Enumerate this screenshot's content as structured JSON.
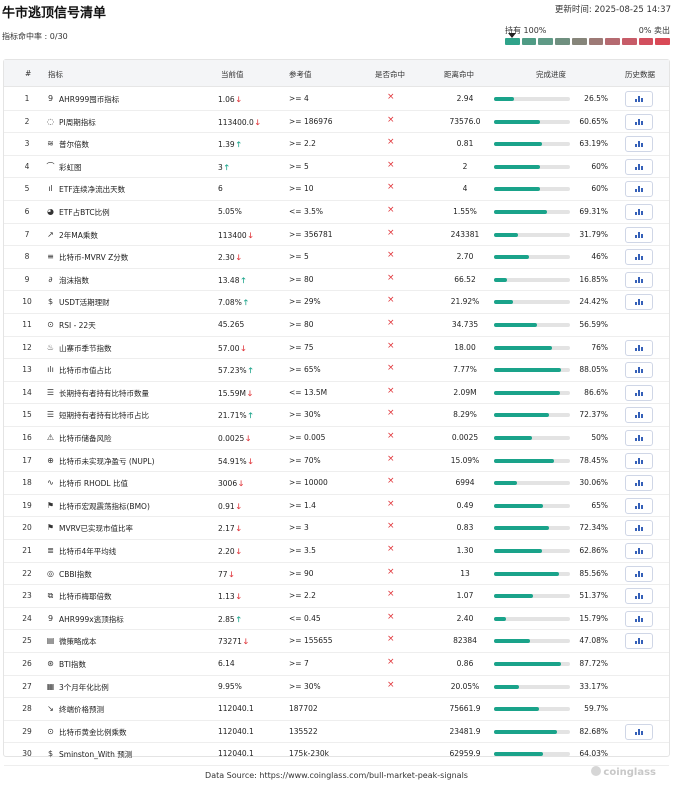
{
  "page": {
    "title": "牛市逃顶信号清单",
    "updated": "更新时间: 2025-08-25 14:37",
    "hit_rate": "指标命中率 : 0/30",
    "hold_label": "持有 100%",
    "sell_label": "0% 卖出"
  },
  "gradient_colors": [
    "#2fa38a",
    "#4f9b84",
    "#5f9a86",
    "#6f8f7f",
    "#86857a",
    "#9d7a76",
    "#b56a70",
    "#c75c68",
    "#d24f5e",
    "#d94956"
  ],
  "headers": {
    "no": "#",
    "name": "指标",
    "current": "当前值",
    "reference": "参考值",
    "hit": "是否命中",
    "distance": "距离命中",
    "progress": "完成进度",
    "history": "历史数据"
  },
  "rows": [
    {
      "no": "1",
      "icon": "square-9-icon",
      "icon_glyph": "9",
      "name": "AHR999囤币指标",
      "current": "1.06",
      "trend": "down",
      "reference": ">= 4",
      "hit": "×",
      "distance": "2.94",
      "progress": 26.5,
      "progress_text": "26.5%",
      "history": true
    },
    {
      "no": "2",
      "icon": "pi-cycle-icon",
      "icon_glyph": "◌",
      "name": "PI周期指标",
      "current": "113400.0",
      "trend": "down",
      "reference": ">= 186976",
      "hit": "×",
      "distance": "73576.0",
      "progress": 60.65,
      "progress_text": "60.65%",
      "history": true
    },
    {
      "no": "3",
      "icon": "puell-icon",
      "icon_glyph": "≋",
      "name": "普尔倍数",
      "current": "1.39",
      "trend": "up",
      "reference": ">= 2.2",
      "hit": "×",
      "distance": "0.81",
      "progress": 63.19,
      "progress_text": "63.19%",
      "history": true
    },
    {
      "no": "4",
      "icon": "rainbow-icon",
      "icon_glyph": "⌒",
      "name": "彩虹图",
      "current": "3",
      "trend": "up",
      "reference": ">= 5",
      "hit": "×",
      "distance": "2",
      "progress": 60,
      "progress_text": "60%",
      "history": true
    },
    {
      "no": "5",
      "icon": "bar-chart-icon",
      "icon_glyph": "ıl",
      "name": "ETF连续净流出天数",
      "current": "6",
      "trend": "",
      "reference": ">= 10",
      "hit": "×",
      "distance": "4",
      "progress": 60,
      "progress_text": "60%",
      "history": true
    },
    {
      "no": "6",
      "icon": "pie-chart-icon",
      "icon_glyph": "◕",
      "name": "ETF占BTC比例",
      "current": "5.05%",
      "trend": "",
      "reference": "<= 3.5%",
      "hit": "×",
      "distance": "1.55%",
      "progress": 69.31,
      "progress_text": "69.31%",
      "history": true
    },
    {
      "no": "7",
      "icon": "area-chart-icon",
      "icon_glyph": "↗",
      "name": "2年MA乘数",
      "current": "113400",
      "trend": "down",
      "reference": ">= 356781",
      "hit": "×",
      "distance": "243381",
      "progress": 31.79,
      "progress_text": "31.79%",
      "history": true
    },
    {
      "no": "8",
      "icon": "list-chart-icon",
      "icon_glyph": "≡",
      "name": "比特币-MVRV Z分数",
      "current": "2.30",
      "trend": "down",
      "reference": ">= 5",
      "hit": "×",
      "distance": "2.70",
      "progress": 46,
      "progress_text": "46%",
      "history": true
    },
    {
      "no": "9",
      "icon": "bubble-icon",
      "icon_glyph": "∂",
      "name": "泡沫指数",
      "current": "13.48",
      "trend": "up",
      "reference": ">= 80",
      "hit": "×",
      "distance": "66.52",
      "progress": 16.85,
      "progress_text": "16.85%",
      "history": true
    },
    {
      "no": "10",
      "icon": "dollar-icon",
      "icon_glyph": "$",
      "name": "USDT活期理财",
      "current": "7.08%",
      "trend": "up",
      "reference": ">= 29%",
      "hit": "×",
      "distance": "21.92%",
      "progress": 24.42,
      "progress_text": "24.42%",
      "history": true
    },
    {
      "no": "11",
      "icon": "rsi-icon",
      "icon_glyph": "⊙",
      "name": "RSI - 22天",
      "current": "45.265",
      "trend": "",
      "reference": ">= 80",
      "hit": "×",
      "distance": "34.735",
      "progress": 56.59,
      "progress_text": "56.59%",
      "history": false
    },
    {
      "no": "12",
      "icon": "altseason-icon",
      "icon_glyph": "♨",
      "name": "山寨币季节指数",
      "current": "57.00",
      "trend": "down",
      "reference": ">= 75",
      "hit": "×",
      "distance": "18.00",
      "progress": 76,
      "progress_text": "76%",
      "history": true
    },
    {
      "no": "13",
      "icon": "dominance-icon",
      "icon_glyph": "ılı",
      "name": "比特币市值占比",
      "current": "57.23%",
      "trend": "up",
      "reference": ">= 65%",
      "hit": "×",
      "distance": "7.77%",
      "progress": 88.05,
      "progress_text": "88.05%",
      "history": true
    },
    {
      "no": "14",
      "icon": "database-icon",
      "icon_glyph": "☰",
      "name": "长期持有者持有比特币数量",
      "current": "15.59M",
      "trend": "down",
      "reference": "<= 13.5M",
      "hit": "×",
      "distance": "2.09M",
      "progress": 86.6,
      "progress_text": "86.6%",
      "history": true
    },
    {
      "no": "15",
      "icon": "database-icon",
      "icon_glyph": "☰",
      "name": "短期持有者持有比特币占比",
      "current": "21.71%",
      "trend": "up",
      "reference": ">= 30%",
      "hit": "×",
      "distance": "8.29%",
      "progress": 72.37,
      "progress_text": "72.37%",
      "history": true
    },
    {
      "no": "16",
      "icon": "reserve-risk-icon",
      "icon_glyph": "⚠",
      "name": "比特币储备风险",
      "current": "0.0025",
      "trend": "down",
      "reference": ">= 0.005",
      "hit": "×",
      "distance": "0.0025",
      "progress": 50,
      "progress_text": "50%",
      "history": true
    },
    {
      "no": "17",
      "icon": "nupl-icon",
      "icon_glyph": "⊕",
      "name": "比特币未实现净盈亏 (NUPL)",
      "current": "54.91%",
      "trend": "down",
      "reference": ">= 70%",
      "hit": "×",
      "distance": "15.09%",
      "progress": 78.45,
      "progress_text": "78.45%",
      "history": true
    },
    {
      "no": "18",
      "icon": "rhodl-icon",
      "icon_glyph": "∿",
      "name": "比特币 RHODL 比值",
      "current": "3006",
      "trend": "down",
      "reference": ">= 10000",
      "hit": "×",
      "distance": "6994",
      "progress": 30.06,
      "progress_text": "30.06%",
      "history": true
    },
    {
      "no": "19",
      "icon": "bmo-icon",
      "icon_glyph": "⚑",
      "name": "比特币宏观震荡指标(BMO)",
      "current": "0.91",
      "trend": "down",
      "reference": ">= 1.4",
      "hit": "×",
      "distance": "0.49",
      "progress": 65,
      "progress_text": "65%",
      "history": true
    },
    {
      "no": "20",
      "icon": "mvrv-icon",
      "icon_glyph": "⚑",
      "name": "MVRV已实现市值比率",
      "current": "2.17",
      "trend": "down",
      "reference": ">= 3",
      "hit": "×",
      "distance": "0.83",
      "progress": 72.34,
      "progress_text": "72.34%",
      "history": true
    },
    {
      "no": "21",
      "icon": "ma4y-icon",
      "icon_glyph": "≣",
      "name": "比特币4年平均线",
      "current": "2.20",
      "trend": "down",
      "reference": ">= 3.5",
      "hit": "×",
      "distance": "1.30",
      "progress": 62.86,
      "progress_text": "62.86%",
      "history": true
    },
    {
      "no": "22",
      "icon": "cbbi-icon",
      "icon_glyph": "◎",
      "name": "CBBI指数",
      "current": "77",
      "trend": "down",
      "reference": ">= 90",
      "hit": "×",
      "distance": "13",
      "progress": 85.56,
      "progress_text": "85.56%",
      "history": true
    },
    {
      "no": "23",
      "icon": "mayer-icon",
      "icon_glyph": "⧉",
      "name": "比特币梅耶倍数",
      "current": "1.13",
      "trend": "down",
      "reference": ">= 2.2",
      "hit": "×",
      "distance": "1.07",
      "progress": 51.37,
      "progress_text": "51.37%",
      "history": true
    },
    {
      "no": "24",
      "icon": "square-9-icon",
      "icon_glyph": "9",
      "name": "AHR999x逃顶指标",
      "current": "2.85",
      "trend": "up",
      "reference": "<= 0.45",
      "hit": "×",
      "distance": "2.40",
      "progress": 15.79,
      "progress_text": "15.79%",
      "history": true
    },
    {
      "no": "25",
      "icon": "microstrategy-icon",
      "icon_glyph": "▤",
      "name": "微策略成本",
      "current": "73271",
      "trend": "down",
      "reference": ">= 155655",
      "hit": "×",
      "distance": "82384",
      "progress": 47.08,
      "progress_text": "47.08%",
      "history": true
    },
    {
      "no": "26",
      "icon": "bti-icon",
      "icon_glyph": "⊛",
      "name": "BTI指数",
      "current": "6.14",
      "trend": "",
      "reference": ">= 7",
      "hit": "×",
      "distance": "0.86",
      "progress": 87.72,
      "progress_text": "87.72%",
      "history": false
    },
    {
      "no": "27",
      "icon": "calendar-icon",
      "icon_glyph": "▦",
      "name": "3个月年化比例",
      "current": "9.95%",
      "trend": "",
      "reference": ">= 30%",
      "hit": "×",
      "distance": "20.05%",
      "progress": 33.17,
      "progress_text": "33.17%",
      "history": false
    },
    {
      "no": "28",
      "icon": "trend-icon",
      "icon_glyph": "↘",
      "name": "终端价格预测",
      "current": "112040.1",
      "trend": "",
      "reference": "187702",
      "hit": "",
      "distance": "75661.9",
      "progress": 59.7,
      "progress_text": "59.7%",
      "history": false
    },
    {
      "no": "29",
      "icon": "gold-ratio-icon",
      "icon_glyph": "⊙",
      "name": "比特币黄金比例乘数",
      "current": "112040.1",
      "trend": "",
      "reference": "135522",
      "hit": "",
      "distance": "23481.9",
      "progress": 82.68,
      "progress_text": "82.68%",
      "history": true
    },
    {
      "no": "30",
      "icon": "smin-icon",
      "icon_glyph": "$",
      "name": "Sminston_With 预测",
      "current": "112040.1",
      "trend": "",
      "reference": "175k-230k",
      "hit": "",
      "distance": "62959.9",
      "progress": 64.03,
      "progress_text": "64.03%",
      "history": false
    }
  ],
  "footer": {
    "source": "Data Source: https://www.coinglass.com/bull-market-peak-signals",
    "brand": "coinglass"
  }
}
